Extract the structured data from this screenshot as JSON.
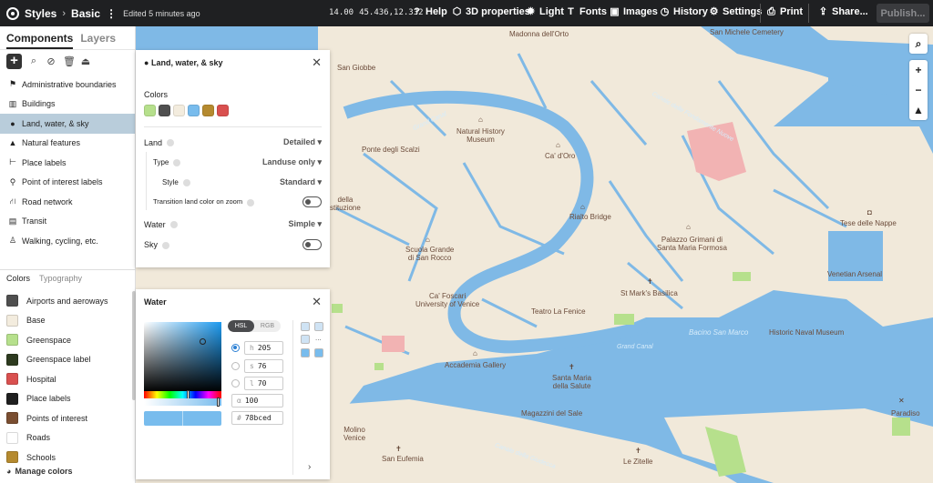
{
  "topbar": {
    "crumb1": "Styles",
    "crumb2": "Basic",
    "edited": "Edited 5 minutes ago",
    "zoom": "14.00",
    "coords": "45.436,12.332",
    "help": "Help",
    "props3d": "3D properties",
    "light": "Light",
    "fonts": "Fonts",
    "images": "Images",
    "history": "History",
    "settings": "Settings",
    "print": "Print",
    "share": "Share...",
    "publish": "Publish..."
  },
  "sidebar": {
    "tab_components": "Components",
    "tab_layers": "Layers",
    "components": [
      {
        "label": "Administrative boundaries",
        "icon": "flag-icon"
      },
      {
        "label": "Buildings",
        "icon": "building-icon"
      },
      {
        "label": "Land, water, & sky",
        "icon": "globe-icon"
      },
      {
        "label": "Natural features",
        "icon": "mountain-icon"
      },
      {
        "label": "Place labels",
        "icon": "label-icon"
      },
      {
        "label": "Point of interest labels",
        "icon": "pin-icon"
      },
      {
        "label": "Road network",
        "icon": "road-icon"
      },
      {
        "label": "Transit",
        "icon": "train-icon"
      },
      {
        "label": "Walking, cycling, etc.",
        "icon": "walk-icon"
      }
    ],
    "tab_colors": "Colors",
    "tab_typography": "Typography",
    "colors": [
      {
        "label": "Airports and aeroways",
        "color": "#4f4f4f"
      },
      {
        "label": "Base",
        "color": "#f3ecde"
      },
      {
        "label": "Greenspace",
        "color": "#b6e08c"
      },
      {
        "label": "Greenspace label",
        "color": "#2d3a1f"
      },
      {
        "label": "Hospital",
        "color": "#d9504f"
      },
      {
        "label": "Place labels",
        "color": "#1f1f1f"
      },
      {
        "label": "Points of interest",
        "color": "#7a4e31"
      },
      {
        "label": "Roads",
        "color": "#ffffff"
      },
      {
        "label": "Schools",
        "color": "#b58a2f"
      }
    ],
    "manage": "Manage colors"
  },
  "land_panel": {
    "title": "Land, water, & sky",
    "colors_label": "Colors",
    "swatches": [
      "#b6e08c",
      "#4f4f4f",
      "#f3ecde",
      "#78bced",
      "#b58a2f",
      "#d9504f"
    ],
    "land": "Land",
    "land_value": "Detailed",
    "type": "Type",
    "type_value": "Landuse only",
    "style": "Style",
    "style_value": "Standard",
    "transition": "Transition land color on zoom",
    "water": "Water",
    "water_value": "Simple",
    "sky": "Sky"
  },
  "water_panel": {
    "title": "Water",
    "hsl": "HSL",
    "rgb": "RGB",
    "h_label": "h",
    "h": "205",
    "s_label": "s",
    "s": "76",
    "l_label": "l",
    "l": "70",
    "a_label": "α",
    "a": "100",
    "hash": "#",
    "hex": "78bced",
    "more": "..."
  },
  "map_labels": {
    "madonna": "Madonna dell'Orto",
    "michele": "San Michele Cemetery",
    "giobbe": "San Giobbe",
    "canale": "Canale delle Fondamente Nuove",
    "grand_canal": "Grand Canal",
    "nat_hist": "Natural History\nMuseum",
    "scalzi": "Ponte degli Scalzi",
    "doro": "Ca' d'Oro",
    "rialto": "Rialto Bridge",
    "costit": "della\nstituzione",
    "scuola": "Scuola Grande\ndi San Rocco",
    "grimani": "Palazzo Grimani di\nSanta Maria Formosa",
    "foscari": "Ca' Foscari\nUniversity of Venice",
    "marco": "St Mark's Basilica",
    "fenice": "Teatro La Fenice",
    "accademia": "Accademia Gallery",
    "bacino": "Bacino San Marco",
    "grand_canal2": "Grand Canal",
    "salute": "Santa Maria\ndella Salute",
    "magazzini": "Magazzini del Sale",
    "molino": "Molino\nVenice",
    "eufemia": "San Eufemia",
    "giudecca": "Canale della Giudecca",
    "zitelle": "Le Zitelle",
    "naval": "Historic Naval Museum",
    "tese": "Tese delle Nappe",
    "arsenal": "Venetian Arsenal",
    "paradiso": "Paradiso"
  }
}
